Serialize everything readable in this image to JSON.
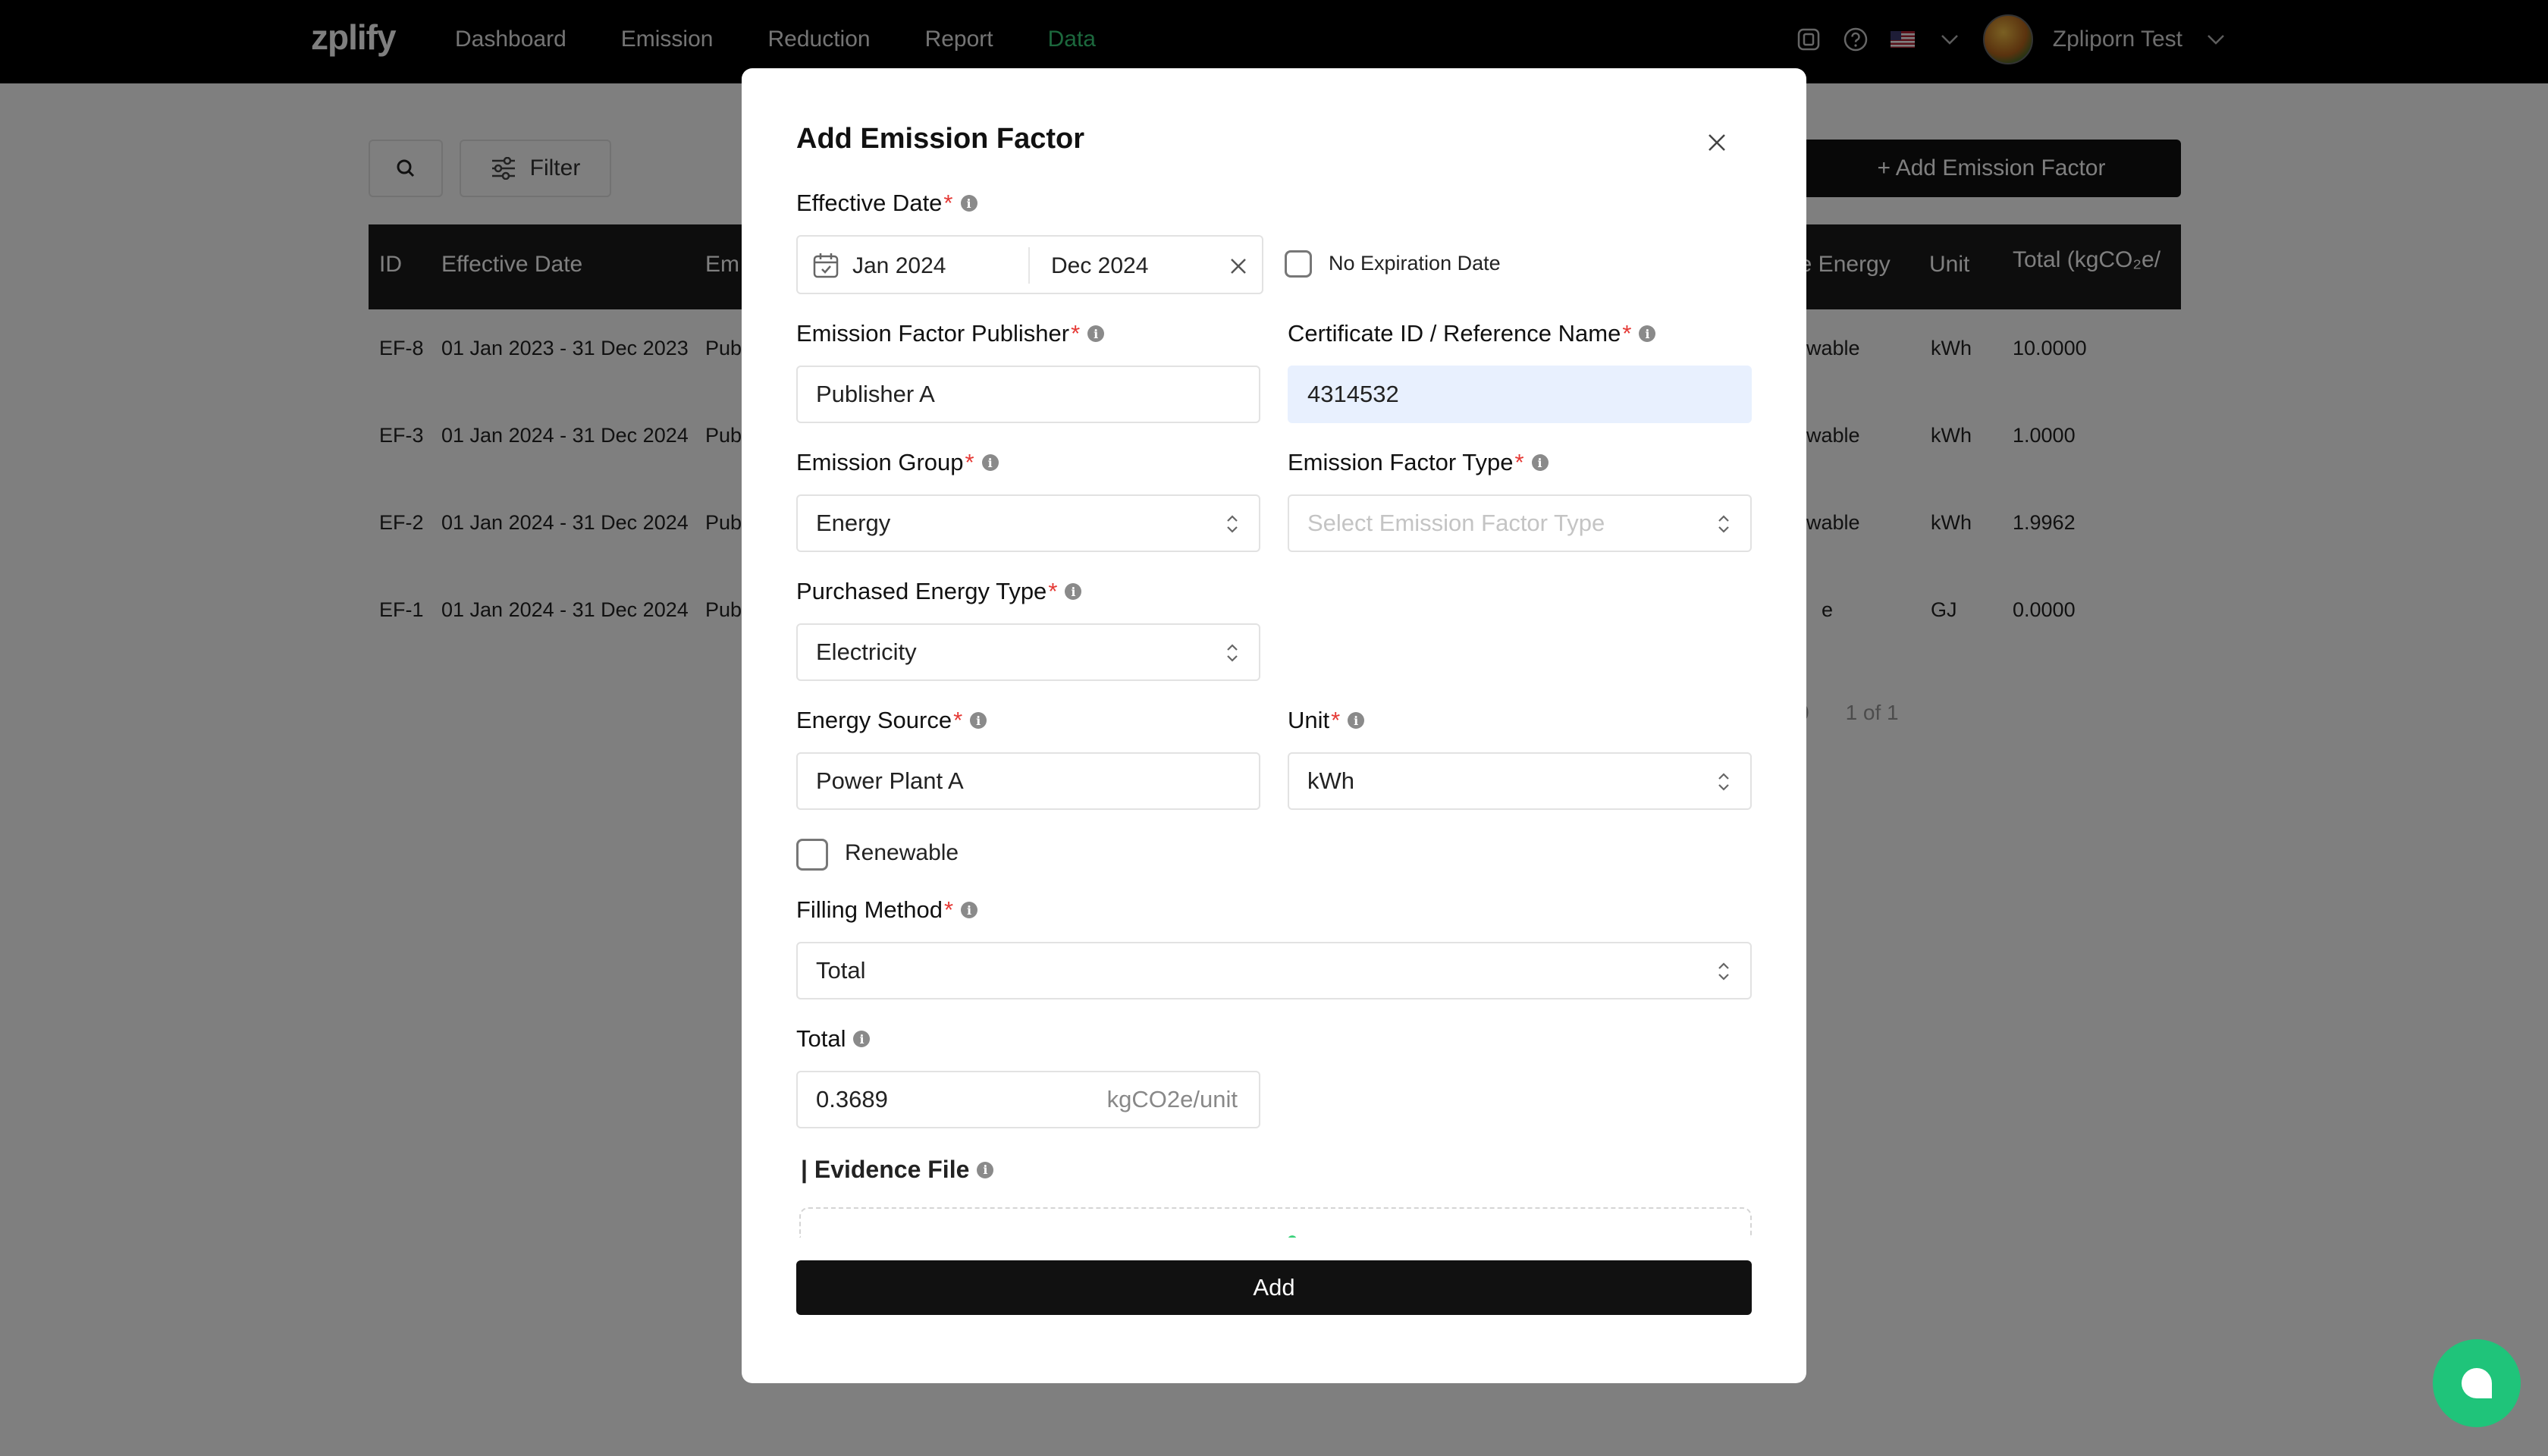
{
  "nav": {
    "logo": "zplify",
    "items": [
      "Dashboard",
      "Emission",
      "Reduction",
      "Report",
      "Data"
    ],
    "active": "Data",
    "user_name": "Zpliporn Test",
    "icons": [
      "layout-icon",
      "help-icon",
      "us-flag-icon",
      "chevron-down-icon"
    ]
  },
  "page": {
    "filter_label": "Filter",
    "add_button": "+ Add Emission Factor",
    "table": {
      "headers": {
        "id": "ID",
        "effective_date": "Effective Date",
        "emission": "Em",
        "renewable": "le Energy",
        "unit": "Unit",
        "total": "Total (kgCO₂e/"
      },
      "rows": [
        {
          "id": "EF-8",
          "date": "01 Jan 2023 - 31 Dec 2023",
          "publisher": "Pub",
          "energy": "wable",
          "unit": "kWh",
          "total": "10.0000"
        },
        {
          "id": "EF-3",
          "date": "01 Jan 2024 - 31 Dec 2024",
          "publisher": "Pub",
          "energy": "wable",
          "unit": "kWh",
          "total": "1.0000"
        },
        {
          "id": "EF-2",
          "date": "01 Jan 2024 - 31 Dec 2024",
          "publisher": "Pub",
          "energy": "wable",
          "unit": "kWh",
          "total": "1.9962"
        },
        {
          "id": "EF-1",
          "date": "01 Jan 2024 - 31 Dec 2024",
          "publisher": "Pub",
          "energy": "e",
          "unit": "GJ",
          "total": "0.0000"
        }
      ]
    },
    "pagination": {
      "page_size": "0",
      "range": "1 of 1"
    }
  },
  "modal": {
    "title": "Add Emission Factor",
    "effective_date": {
      "label": "Effective Date",
      "start": "Jan 2024",
      "end": "Dec 2024",
      "no_expiration_label": "No Expiration Date",
      "no_expiration_checked": false
    },
    "publisher": {
      "label": "Emission Factor Publisher",
      "value": "Publisher A"
    },
    "certificate": {
      "label": "Certificate ID / Reference Name",
      "value": "4314532"
    },
    "emission_group": {
      "label": "Emission Group",
      "value": "Energy"
    },
    "emission_factor_type": {
      "label": "Emission Factor Type",
      "placeholder": "Select Emission Factor Type"
    },
    "purchased_energy_type": {
      "label": "Purchased Energy Type",
      "value": "Electricity"
    },
    "energy_source": {
      "label": "Energy Source",
      "value": "Power Plant A"
    },
    "unit": {
      "label": "Unit",
      "value": "kWh"
    },
    "renewable": {
      "label": "Renewable",
      "checked": false
    },
    "filling_method": {
      "label": "Filling Method",
      "value": "Total"
    },
    "total": {
      "label": "Total",
      "value": "0.3689",
      "suffix": "kgCO2e/unit"
    },
    "evidence": {
      "label": "| Evidence File"
    },
    "submit_label": "Add"
  },
  "colors": {
    "accent": "#39d17a",
    "required": "#e53935",
    "chat": "#1fc47a",
    "autofill": "#e8f0fe"
  }
}
